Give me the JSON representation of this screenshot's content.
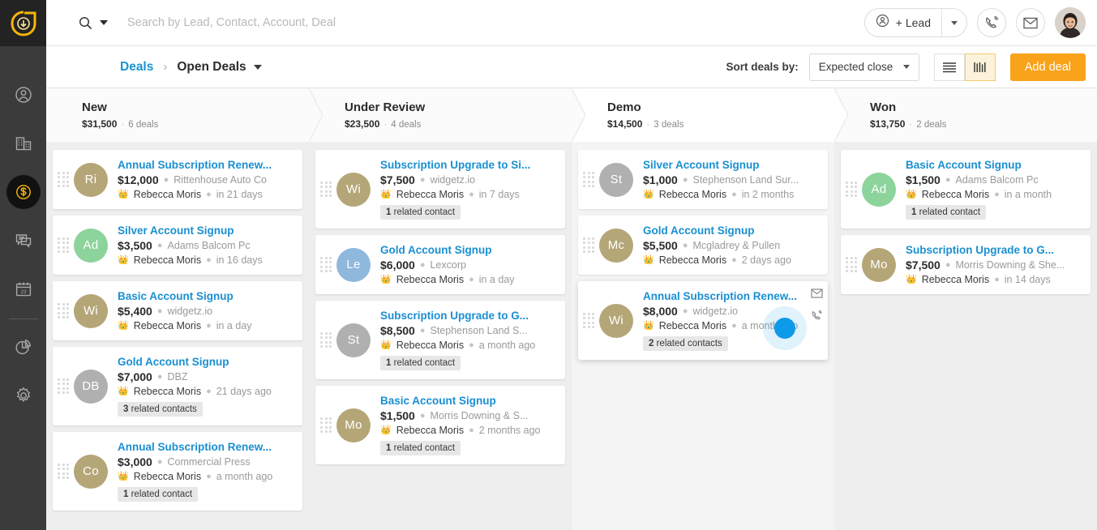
{
  "app": {
    "logo": "crm-logo",
    "brand_yellow": "#f5b50a",
    "accent_blue": "#1a8fd1",
    "accent_orange": "#f9a31b"
  },
  "sidebar": {
    "items": [
      {
        "icon": "contacts-icon",
        "name": "sidebar-item-contacts",
        "active": false
      },
      {
        "icon": "accounts-icon",
        "name": "sidebar-item-accounts",
        "active": false
      },
      {
        "icon": "deals-icon",
        "name": "sidebar-item-deals",
        "active": true
      },
      {
        "icon": "conversations-icon",
        "name": "sidebar-item-conversations",
        "active": false
      },
      {
        "icon": "calendar-icon",
        "name": "sidebar-item-calendar",
        "active": false
      },
      {
        "icon": "reports-icon",
        "name": "sidebar-item-reports",
        "active": false
      },
      {
        "icon": "settings-icon",
        "name": "sidebar-item-settings",
        "active": false
      }
    ]
  },
  "topbar": {
    "search_placeholder": "Search by Lead, Contact, Account, Deal",
    "lead_button_label": "+ Lead",
    "phone_icon": "phone-icon",
    "mail_icon": "envelope-icon",
    "avatar": "user-avatar"
  },
  "breadcrumb": {
    "root": "Deals",
    "separator": "›",
    "current": "Open Deals"
  },
  "toolbar": {
    "sort_label": "Sort deals by:",
    "sort_value": "Expected close",
    "view_list": "list-view",
    "view_kanban": "kanban-view",
    "add_deal_label": "Add deal"
  },
  "stages": [
    {
      "name": "New",
      "amount": "$31,500",
      "deals": "6 deals",
      "active": false
    },
    {
      "name": "Under Review",
      "amount": "$23,500",
      "deals": "4 deals",
      "active": false
    },
    {
      "name": "Demo",
      "amount": "$14,500",
      "deals": "3 deals",
      "active": true
    },
    {
      "name": "Won",
      "amount": "$13,750",
      "deals": "2 deals",
      "active": false
    }
  ],
  "owner_crown": "👑",
  "columns": [
    {
      "stage": "New",
      "cards": [
        {
          "title": "Annual Subscription Renew...",
          "amount": "$12,000",
          "account": "Rittenhouse Auto Co",
          "owner": "Rebecca Moris",
          "time": "in 21 days",
          "initials": "Ri",
          "color": "#b5a678",
          "pill": ""
        },
        {
          "title": "Silver Account Signup",
          "amount": "$3,500",
          "account": "Adams Balcom Pc",
          "owner": "Rebecca Moris",
          "time": "in 16 days",
          "initials": "Ad",
          "color": "#8cd49b",
          "pill": ""
        },
        {
          "title": "Basic Account Signup",
          "amount": "$5,400",
          "account": "widgetz.io",
          "owner": "Rebecca Moris",
          "time": "in a day",
          "initials": "Wi",
          "color": "#b5a678",
          "pill": ""
        },
        {
          "title": "Gold Account Signup",
          "amount": "$7,000",
          "account": "DBZ",
          "owner": "Rebecca Moris",
          "time": "21 days ago",
          "initials": "DB",
          "color": "#b0b0b0",
          "pill": "3 related contacts",
          "pill_count": "3",
          "pill_text": " related contacts"
        },
        {
          "title": "Annual Subscription Renew...",
          "amount": "$3,000",
          "account": "Commercial Press",
          "owner": "Rebecca Moris",
          "time": "a month ago",
          "initials": "Co",
          "color": "#b5a678",
          "pill": "1 related contact",
          "pill_count": "1",
          "pill_text": " related contact"
        }
      ]
    },
    {
      "stage": "Under Review",
      "cards": [
        {
          "title": "Subscription Upgrade to Si...",
          "amount": "$7,500",
          "account": "widgetz.io",
          "owner": "Rebecca Moris",
          "time": "in 7 days",
          "initials": "Wi",
          "color": "#b5a678",
          "pill": "1 related contact",
          "pill_count": "1",
          "pill_text": " related contact"
        },
        {
          "title": "Gold Account Signup",
          "amount": "$6,000",
          "account": "Lexcorp",
          "owner": "Rebecca Moris",
          "time": "in a day",
          "initials": "Le",
          "color": "#8fb8dd",
          "pill": ""
        },
        {
          "title": "Subscription Upgrade to G...",
          "amount": "$8,500",
          "account": "Stephenson Land S...",
          "owner": "Rebecca Moris",
          "time": "a month ago",
          "initials": "St",
          "color": "#b0b0b0",
          "pill": "1 related contact",
          "pill_count": "1",
          "pill_text": " related contact"
        },
        {
          "title": "Basic Account Signup",
          "amount": "$1,500",
          "account": "Morris Downing & S...",
          "owner": "Rebecca Moris",
          "time": "2 months ago",
          "initials": "Mo",
          "color": "#b5a678",
          "pill": "1 related contact",
          "pill_count": "1",
          "pill_text": " related contact"
        }
      ]
    },
    {
      "stage": "Demo",
      "cards": [
        {
          "title": "Silver Account Signup",
          "amount": "$1,000",
          "account": "Stephenson Land Sur...",
          "owner": "Rebecca Moris",
          "time": "in 2 months",
          "initials": "St",
          "color": "#b0b0b0",
          "pill": ""
        },
        {
          "title": "Gold Account Signup",
          "amount": "$5,500",
          "account": "Mcgladrey & Pullen",
          "owner": "Rebecca Moris",
          "time": "2 days ago",
          "initials": "Mc",
          "color": "#b5a678",
          "pill": ""
        },
        {
          "title": "Annual Subscription Renew...",
          "amount": "$8,000",
          "account": "widgetz.io",
          "owner": "Rebecca Moris",
          "time": "a month ago",
          "initials": "Wi",
          "color": "#b5a678",
          "pill": "2 related contacts",
          "pill_count": "2",
          "pill_text": " related contacts",
          "hovered": true
        }
      ]
    },
    {
      "stage": "Won",
      "cards": [
        {
          "title": "Basic Account Signup",
          "amount": "$1,500",
          "account": "Adams Balcom Pc",
          "owner": "Rebecca Moris",
          "time": "in a month",
          "initials": "Ad",
          "color": "#8cd49b",
          "pill": "1 related contact",
          "pill_count": "1",
          "pill_text": " related contact"
        },
        {
          "title": "Subscription Upgrade to G...",
          "amount": "$7,500",
          "account": "Morris Downing & She...",
          "owner": "Rebecca Moris",
          "time": "in 14 days",
          "initials": "Mo",
          "color": "#b5a678",
          "pill": ""
        }
      ]
    }
  ]
}
